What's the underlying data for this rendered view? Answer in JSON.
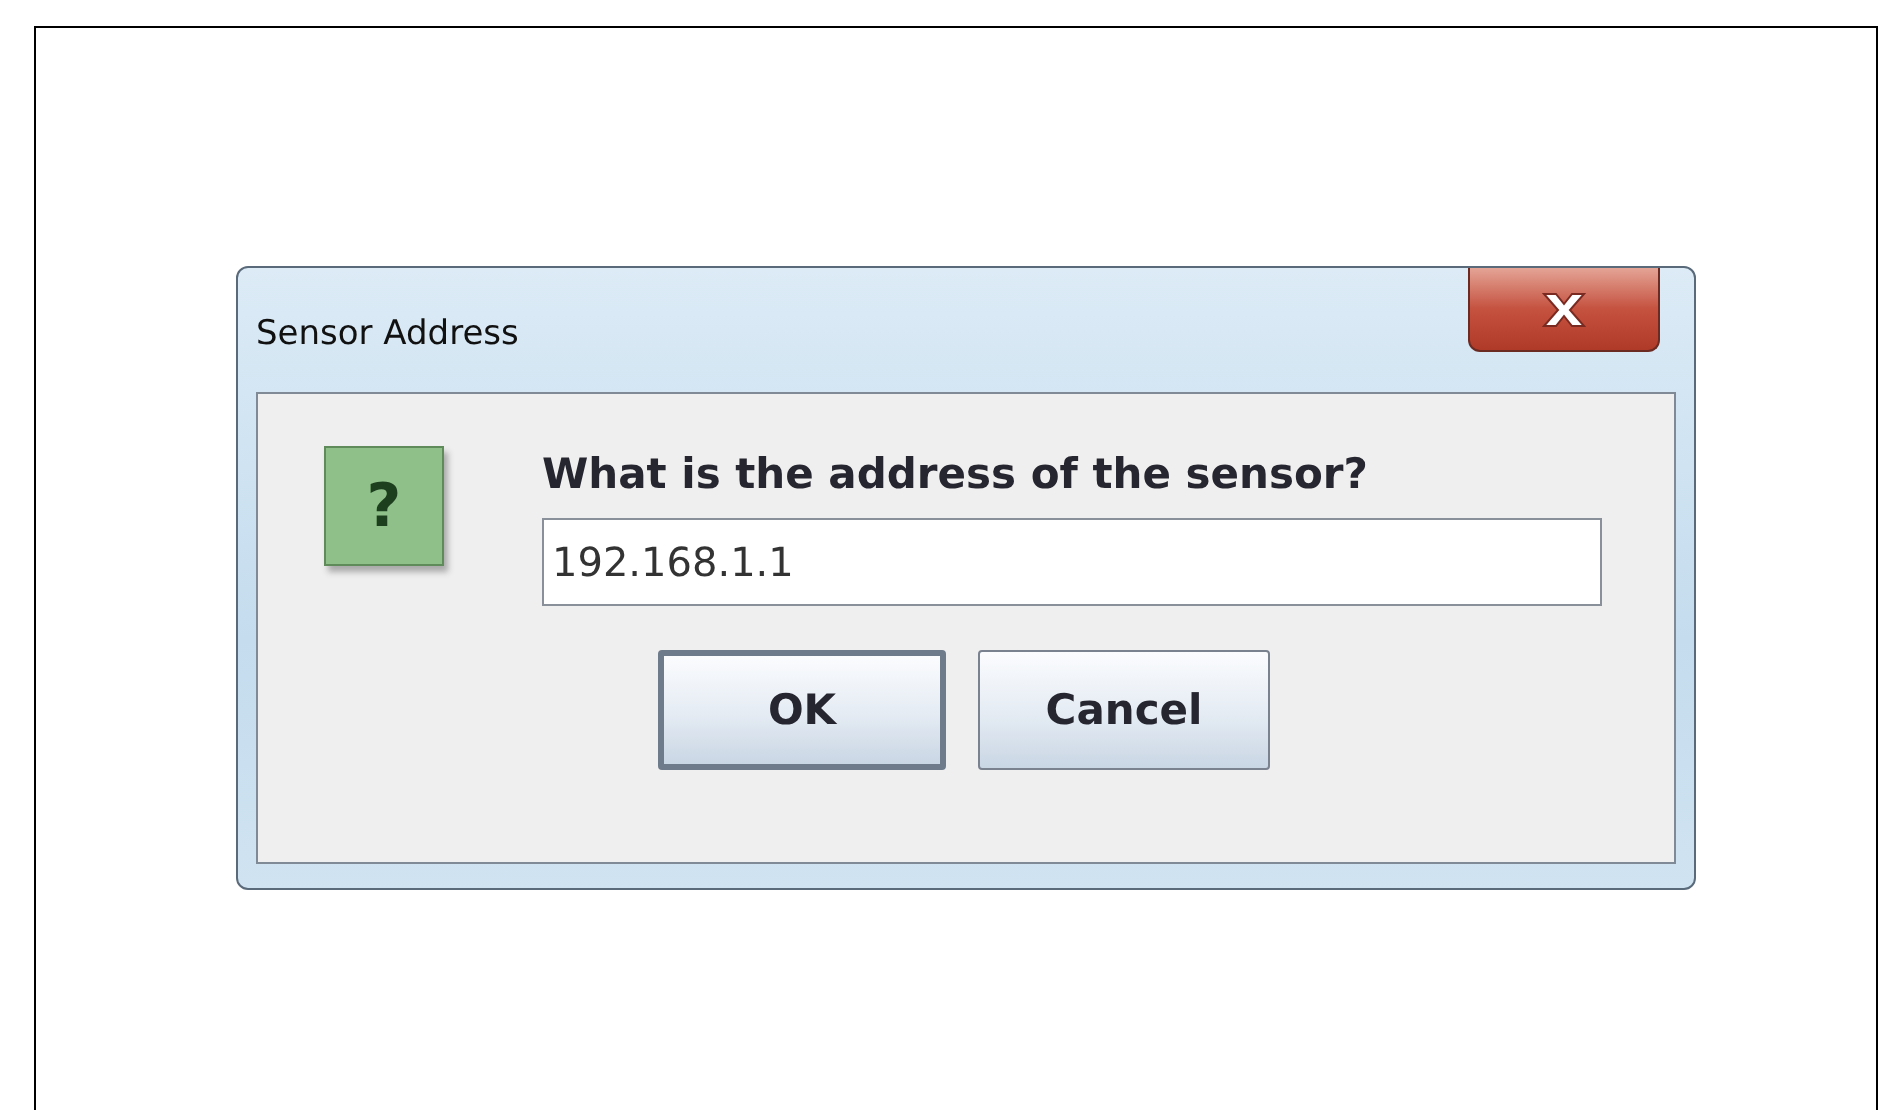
{
  "window": {
    "title": "Sensor Address"
  },
  "dialog": {
    "icon_glyph": "?",
    "question": "What is the address of the sensor?",
    "field": {
      "value": "192.168.1.1"
    }
  },
  "buttons": [
    {
      "label": "OK",
      "selected": true
    },
    {
      "label": "Cancel",
      "selected": false
    }
  ]
}
